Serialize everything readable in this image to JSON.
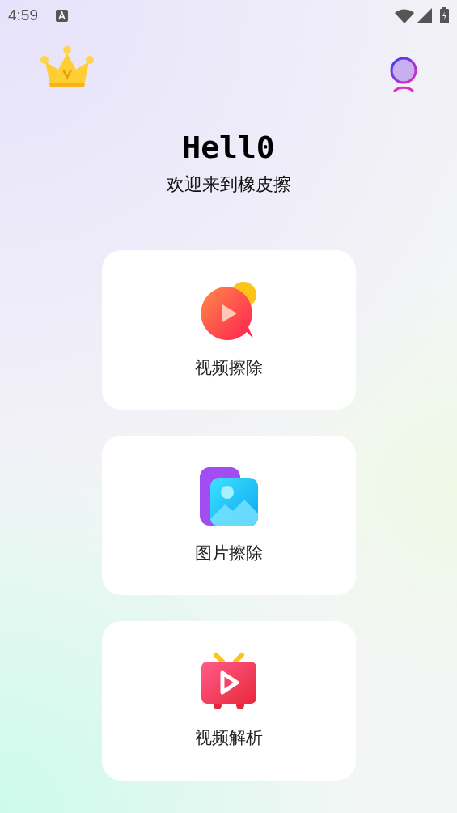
{
  "status_bar": {
    "time": "4:59"
  },
  "greeting": {
    "title": "Hell0",
    "subtitle": "欢迎来到橡皮擦"
  },
  "features": [
    {
      "kind": "video",
      "label": "视频擦除"
    },
    {
      "kind": "image",
      "label": "图片擦除"
    },
    {
      "kind": "tv",
      "label": "视频解析"
    }
  ]
}
